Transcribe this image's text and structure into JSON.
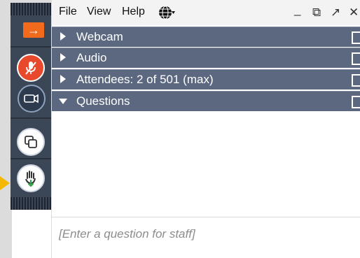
{
  "menu": {
    "file": "File",
    "view": "View",
    "help": "Help",
    "language_icon": "globe-dropdown-icon"
  },
  "window_controls": {
    "minimize": "_",
    "restore": "⧉",
    "popout": "↗",
    "close": "✕"
  },
  "controls": {
    "arrow_label": "→",
    "icons": [
      "arrow-icon",
      "microphone-muted-icon",
      "camera-icon",
      "screen-share-icon",
      "raise-hand-icon"
    ]
  },
  "sections": [
    {
      "label": "Webcam",
      "expanded": false
    },
    {
      "label": "Audio",
      "expanded": false
    },
    {
      "label": "Attendees:  2 of 501 (max)",
      "expanded": false
    },
    {
      "label": "Questions",
      "expanded": true
    }
  ],
  "questions": {
    "placeholder": "[Enter a question for staff]"
  },
  "colors": {
    "section_header": "#5b6880",
    "accent_orange": "#f26b1d",
    "mic_red": "#e8492c",
    "pointer_yellow": "#f5b800"
  }
}
